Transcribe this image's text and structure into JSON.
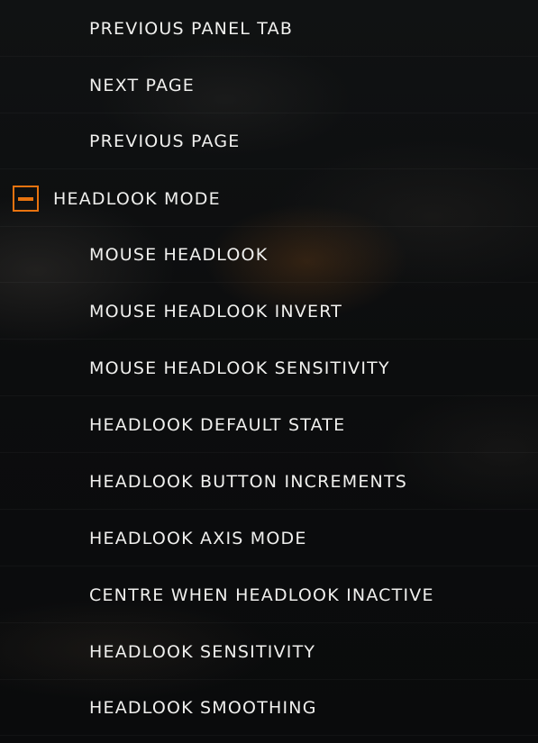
{
  "items": [
    {
      "label": "PREVIOUS PANEL TAB"
    },
    {
      "label": "NEXT PAGE"
    },
    {
      "label": "PREVIOUS PAGE"
    }
  ],
  "group": {
    "label": "HEADLOOK MODE",
    "toggle_icon": "collapse-minus-icon",
    "accent_color": "#e8730f",
    "items": [
      {
        "label": "MOUSE HEADLOOK"
      },
      {
        "label": "MOUSE HEADLOOK INVERT"
      },
      {
        "label": "MOUSE HEADLOOK SENSITIVITY"
      },
      {
        "label": "HEADLOOK DEFAULT STATE"
      },
      {
        "label": "HEADLOOK BUTTON INCREMENTS"
      },
      {
        "label": "HEADLOOK AXIS MODE"
      },
      {
        "label": "CENTRE WHEN HEADLOOK INACTIVE"
      },
      {
        "label": "HEADLOOK SENSITIVITY"
      },
      {
        "label": "HEADLOOK SMOOTHING"
      }
    ]
  }
}
